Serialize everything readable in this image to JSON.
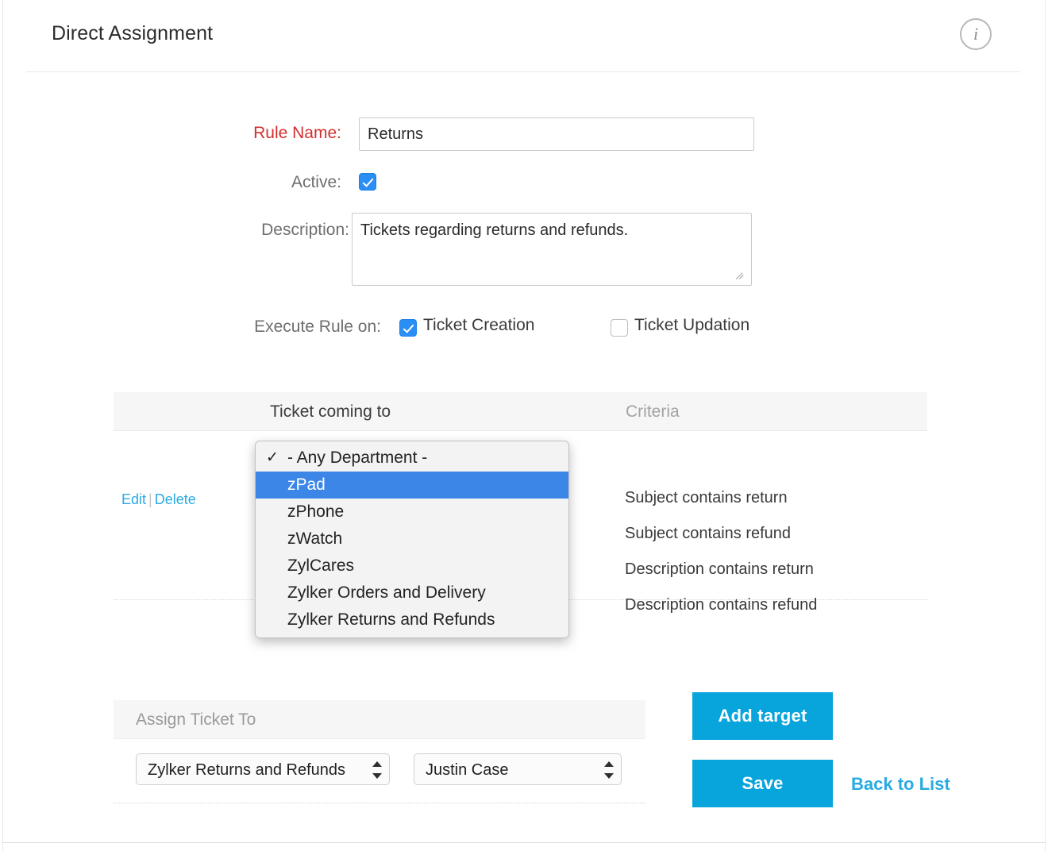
{
  "header": {
    "title": "Direct Assignment",
    "info_icon": "info-icon",
    "info_glyph": "i"
  },
  "form": {
    "rule_name": {
      "label": "Rule Name:",
      "value": "Returns",
      "placeholder": ""
    },
    "active": {
      "label": "Active:",
      "checked": true
    },
    "description": {
      "label": "Description:",
      "value": "Tickets regarding returns and refunds.",
      "placeholder": ""
    },
    "execute_rule_on": {
      "label": "Execute Rule on:",
      "options": [
        {
          "label": "Ticket Creation",
          "checked": true
        },
        {
          "label": "Ticket Updation",
          "checked": false
        }
      ]
    }
  },
  "targets_table": {
    "columns": {
      "actions": "",
      "coming_to": "Ticket coming to",
      "criteria": "Criteria"
    },
    "row": {
      "edit_label": "Edit",
      "separator": "|",
      "delete_label": "Delete",
      "criteria": [
        "Subject contains return",
        "Subject contains refund",
        "Description contains return",
        "Description contains refund"
      ]
    }
  },
  "department_dropdown": {
    "open": true,
    "items": [
      {
        "label": "- Any Department -",
        "checked": true,
        "highlighted": false
      },
      {
        "label": "zPad",
        "checked": false,
        "highlighted": true
      },
      {
        "label": "zPhone",
        "checked": false,
        "highlighted": false
      },
      {
        "label": "zWatch",
        "checked": false,
        "highlighted": false
      },
      {
        "label": "ZylCares",
        "checked": false,
        "highlighted": false
      },
      {
        "label": "Zylker Orders and Delivery",
        "checked": false,
        "highlighted": false
      },
      {
        "label": "Zylker Returns and Refunds",
        "checked": false,
        "highlighted": false
      }
    ]
  },
  "assign_panel": {
    "title": "Assign Ticket To",
    "department_select": {
      "value": "Zylker Returns and Refunds"
    },
    "agent_select": {
      "value": "Justin Case"
    }
  },
  "actions": {
    "add_target": "Add target",
    "save": "Save",
    "back_to_list": "Back to List"
  },
  "colors": {
    "accent_blue": "#08a4dc",
    "link_blue": "#29abe2",
    "checkbox_blue": "#2b8ef5",
    "selection_blue": "#3c86e8",
    "required_red": "#d32f2f",
    "panel_gray": "#f6f6f6"
  }
}
